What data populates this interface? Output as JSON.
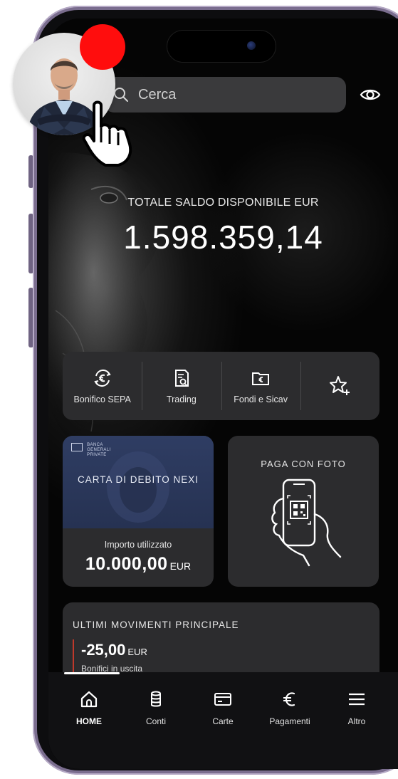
{
  "search": {
    "placeholder": "Cerca"
  },
  "balance": {
    "label": "TOTALE SALDO DISPONIBILE EUR",
    "value": "1.598.359,14"
  },
  "quick_actions": [
    {
      "label": "Bonifico SEPA",
      "icon": "euro-transfer-icon"
    },
    {
      "label": "Trading",
      "icon": "trading-document-icon"
    },
    {
      "label": "Fondi e Sicav",
      "icon": "euro-folder-icon"
    },
    {
      "label": "",
      "icon": "star-add-icon"
    }
  ],
  "debit_card": {
    "brand_line1": "BANCA",
    "brand_line2": "GENERALI",
    "brand_line3": "PRIVATE",
    "title": "CARTA DI DEBITO NEXI",
    "used_label": "Importo utilizzato",
    "used_amount": "10.000,00",
    "currency": "EUR"
  },
  "photo_pay": {
    "title": "PAGA CON FOTO",
    "icon": "hand-phone-qr-icon"
  },
  "movements": {
    "title": "ULTIMI MOVIMENTI PRINCIPALE",
    "amount": "-25,00",
    "currency": "EUR",
    "type": "Bonifici in uscita"
  },
  "nav": [
    {
      "label": "HOME",
      "icon": "home-icon",
      "active": true
    },
    {
      "label": "Conti",
      "icon": "coins-icon"
    },
    {
      "label": "Carte",
      "icon": "card-icon"
    },
    {
      "label": "Pagamenti",
      "icon": "euro-icon"
    },
    {
      "label": "Altro",
      "icon": "menu-icon"
    }
  ],
  "colors": {
    "background": "#050505",
    "panel": "#2c2c2e",
    "card_blue": "#2f3d63",
    "notification": "#ff0d0d",
    "movement_bar": "#c0392b"
  }
}
